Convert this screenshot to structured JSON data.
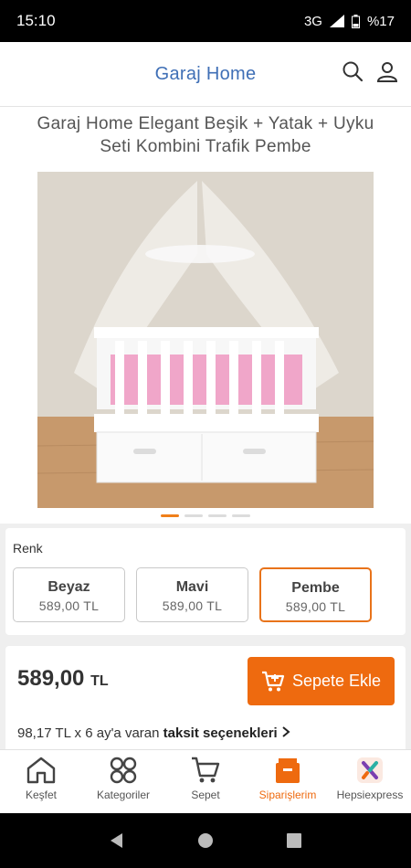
{
  "status_bar": {
    "time": "15:10",
    "network": "3G",
    "battery": "%17"
  },
  "header": {
    "brand": "Garaj Home"
  },
  "product": {
    "title": "Garaj Home Elegant Beşik + Yatak + Uyku Seti Kombini Trafik Pembe",
    "image_dots": 4,
    "active_dot": 1
  },
  "variants": {
    "label": "Renk",
    "options": [
      {
        "name": "Beyaz",
        "price": "589,00 TL"
      },
      {
        "name": "Mavi",
        "price": "589,00 TL"
      },
      {
        "name": "Pembe",
        "price": "589,00 TL",
        "selected": true
      }
    ]
  },
  "buy_box": {
    "price": "589,00",
    "currency": "TL",
    "add_to_cart_label": "Sepete Ekle",
    "installment_text": "98,17 TL x 6 ay'a varan ",
    "installment_link": "taksit seçenekleri"
  },
  "bottom_nav": [
    {
      "label": "Keşfet",
      "icon": "home-icon"
    },
    {
      "label": "Kategoriler",
      "icon": "categories-icon"
    },
    {
      "label": "Sepet",
      "icon": "cart-icon"
    },
    {
      "label": "Siparişlerim",
      "icon": "orders-icon",
      "active": true
    },
    {
      "label": "Hepsiexpress",
      "icon": "hepsiexpress-icon"
    }
  ],
  "colors": {
    "brand_blue": "#3f6fb6",
    "accent_orange": "#ee6a0f"
  }
}
